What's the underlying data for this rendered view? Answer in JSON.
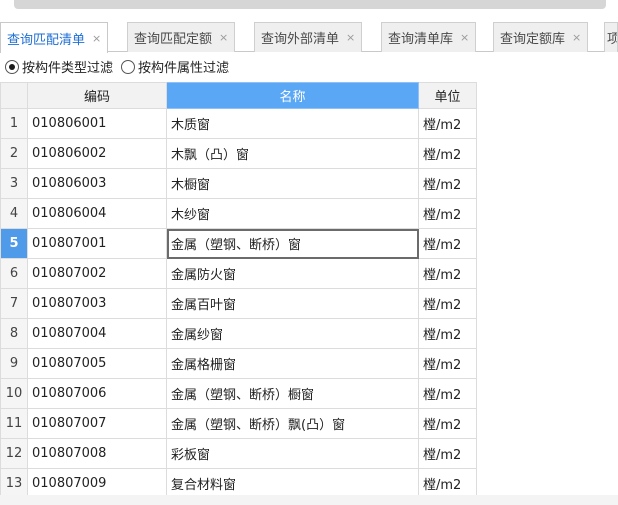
{
  "tabs": [
    {
      "label": "查询匹配清单",
      "active": true
    },
    {
      "label": "查询匹配定额",
      "active": false
    },
    {
      "label": "查询外部清单",
      "active": false
    },
    {
      "label": "查询清单库",
      "active": false
    },
    {
      "label": "查询定额库",
      "active": false
    },
    {
      "label": "项",
      "active": false
    }
  ],
  "close_glyph": "×",
  "filters": {
    "by_type": "按构件类型过滤",
    "by_attr": "按构件属性过滤",
    "selected": "by_type"
  },
  "table": {
    "headers": {
      "code": "编码",
      "name": "名称",
      "unit": "单位"
    },
    "current_row": 5,
    "rows": [
      {
        "idx": "1",
        "code": "010806001",
        "name": "木质窗",
        "unit": "樘/m2"
      },
      {
        "idx": "2",
        "code": "010806002",
        "name": "木飘（凸）窗",
        "unit": "樘/m2"
      },
      {
        "idx": "3",
        "code": "010806003",
        "name": "木橱窗",
        "unit": "樘/m2"
      },
      {
        "idx": "4",
        "code": "010806004",
        "name": "木纱窗",
        "unit": "樘/m2"
      },
      {
        "idx": "5",
        "code": "010807001",
        "name": "金属（塑钢、断桥）窗",
        "unit": "樘/m2"
      },
      {
        "idx": "6",
        "code": "010807002",
        "name": "金属防火窗",
        "unit": "樘/m2"
      },
      {
        "idx": "7",
        "code": "010807003",
        "name": "金属百叶窗",
        "unit": "樘/m2"
      },
      {
        "idx": "8",
        "code": "010807004",
        "name": "金属纱窗",
        "unit": "樘/m2"
      },
      {
        "idx": "9",
        "code": "010807005",
        "name": "金属格栅窗",
        "unit": "樘/m2"
      },
      {
        "idx": "10",
        "code": "010807006",
        "name": "金属（塑钢、断桥）橱窗",
        "unit": "樘/m2"
      },
      {
        "idx": "11",
        "code": "010807007",
        "name": "金属（塑钢、断桥）飘(凸）窗",
        "unit": "樘/m2"
      },
      {
        "idx": "12",
        "code": "010807008",
        "name": "彩板窗",
        "unit": "樘/m2"
      },
      {
        "idx": "13",
        "code": "010807009",
        "name": "复合材料窗",
        "unit": "樘/m2"
      }
    ]
  },
  "colors": {
    "accent": "#1e6fd6",
    "selected_header": "#5aa7f5",
    "current_row_index": "#4f9bea"
  }
}
